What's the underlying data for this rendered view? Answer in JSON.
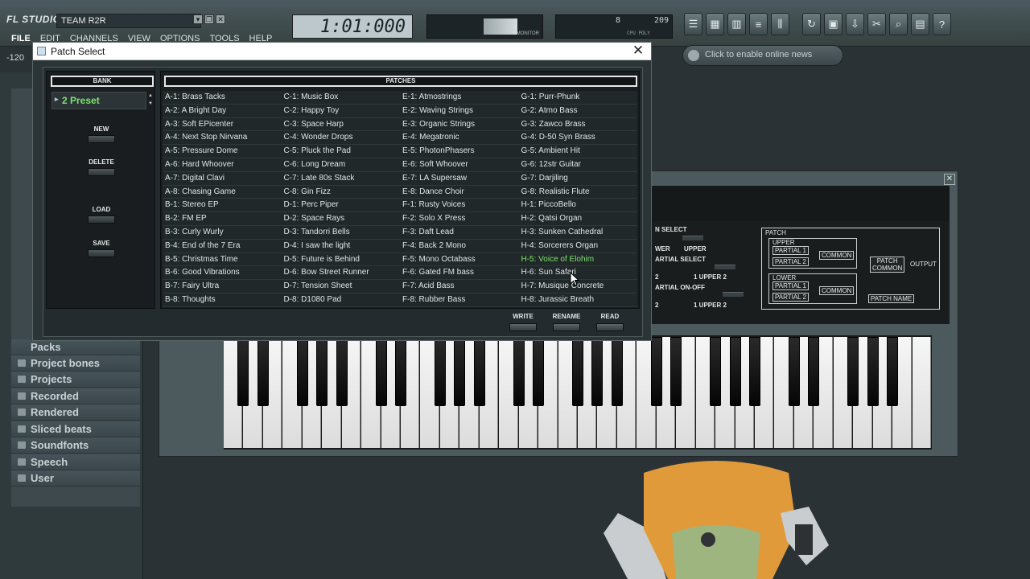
{
  "fl": {
    "logo": "FL STUDIO",
    "title": "TEAM R2R",
    "menu": [
      "FILE",
      "EDIT",
      "CHANNELS",
      "VIEW",
      "OPTIONS",
      "TOOLS",
      "HELP"
    ],
    "tempo": "-120",
    "song_position": "1:01:000",
    "meter_label": "MONITOR",
    "cpu_left": "8",
    "cpu_right": "209",
    "cpu_sub": "CPU POLY",
    "news": "Click to enable online news"
  },
  "sidebar": {
    "items": [
      "Packs",
      "Project bones",
      "Projects",
      "Recorded",
      "Rendered",
      "Sliced beats",
      "Soundfonts",
      "Speech",
      "User"
    ]
  },
  "plugin": {
    "patch_label": "PATCH",
    "upper": "UPPER",
    "lower": "LOWER",
    "partial1": "PARTIAL 1",
    "partial2": "PARTIAL 2",
    "common": "COMMON",
    "patch_common_1": "PATCH",
    "patch_common_2": "COMMON",
    "output": "OUTPUT",
    "patch_name": "PATCH NAME",
    "select_1": "N SELECT",
    "select_2": "WER",
    "select_3": "UPPER",
    "select_4": "ARTIAL SELECT",
    "select_5": "1 UPPER 2",
    "select_6": "ARTIAL ON-OFF",
    "select_7": "1 UPPER 2",
    "select_8": "2",
    "select_9": "2"
  },
  "dialog": {
    "title": "Patch Select",
    "bank_header": "BANK",
    "patches_header": "PATCHES",
    "bank_selected": "2 Preset",
    "bank_buttons": {
      "new": "NEW",
      "delete": "DELETE",
      "load": "LOAD",
      "save": "SAVE"
    },
    "actions": {
      "write": "WRITE",
      "rename": "RENAME",
      "read": "READ"
    },
    "patches": [
      [
        "A-1: Brass Tacks",
        "C-1: Music Box",
        "E-1: Atmostrings",
        "G-1: Purr-Phunk"
      ],
      [
        "A-2: A Bright Day",
        "C-2: Happy Toy",
        "E-2: Waving Strings",
        "G-2: Atmo Bass"
      ],
      [
        "A-3: Soft EPicenter",
        "C-3: Space Harp",
        "E-3: Organic Strings",
        "G-3: Zawco Brass"
      ],
      [
        "A-4: Next Stop Nirvana",
        "C-4: Wonder Drops",
        "E-4: Megatronic",
        "G-4: D-50 Syn Brass"
      ],
      [
        "A-5: Pressure Dome",
        "C-5: Pluck the Pad",
        "E-5: PhotonPhasers",
        "G-5: Ambient Hit"
      ],
      [
        "A-6: Hard Whoover",
        "C-6: Long Dream",
        "E-6: Soft Whoover",
        "G-6: 12str Guitar"
      ],
      [
        "A-7: Digital Clavi",
        "C-7: Late 80s Stack",
        "E-7: LA Supersaw",
        "G-7: Darjiling"
      ],
      [
        "A-8: Chasing Game",
        "C-8: Gin Fizz",
        "E-8: Dance Choir",
        "G-8: Realistic Flute"
      ],
      [
        "B-1: Stereo EP",
        "D-1: Perc Piper",
        "F-1: Rusty Voices",
        "H-1: PiccoBello"
      ],
      [
        "B-2: FM EP",
        "D-2: Space Rays",
        "F-2: Solo X Press",
        "H-2: Qatsi Organ"
      ],
      [
        "B-3: Curly Wurly",
        "D-3: Tandorri Bells",
        "F-3: Daft Lead",
        "H-3: Sunken Cathedral"
      ],
      [
        "B-4: End of the 7 Era",
        "D-4: I saw the light",
        "F-4: Back 2 Mono",
        "H-4: Sorcerers Organ"
      ],
      [
        "B-5: Christmas Time",
        "D-5: Future is Behind",
        "F-5: Mono Octabass",
        "H-5: Voice of Elohim"
      ],
      [
        "B-6: Good Vibrations",
        "D-6: Bow Street Runner",
        "F-6: Gated FM bass",
        "H-6: Sun Safari"
      ],
      [
        "B-7: Fairy Ultra",
        "D-7: Tension Sheet",
        "F-7: Acid Bass",
        "H-7: Musique Concrete"
      ],
      [
        "B-8: Thoughts",
        "D-8: D1080 Pad",
        "F-8: Rubber Bass",
        "H-8: Jurassic Breath"
      ]
    ],
    "selected_patch": "H-5: Voice of Elohim"
  },
  "colors": {
    "accent_green": "#7de36f",
    "panel_dark": "#191d1f"
  }
}
